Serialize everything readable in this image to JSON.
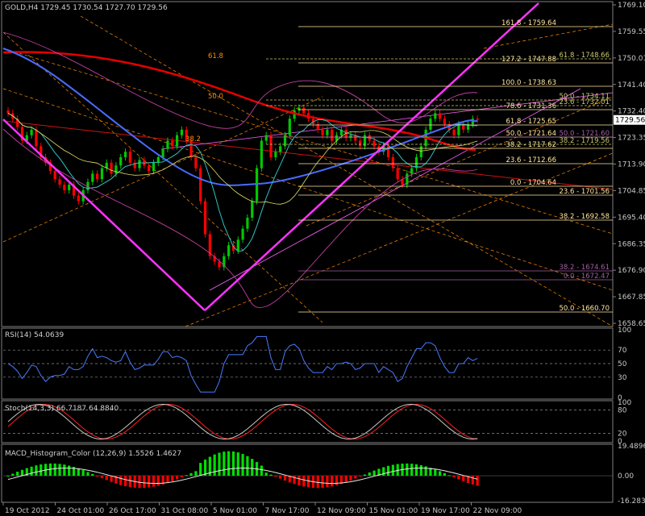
{
  "window": {
    "header_text": "GOLD,H4  1729.45 1730.54 1727.70 1729.56"
  },
  "colors": {
    "background": "#000000",
    "bull_candle": "#00c800",
    "bear_candle": "#ff0000",
    "ma_red": "#e60000",
    "ma_blue": "#4a6bff",
    "bollinger": "#c040a0",
    "trend_magenta": "#ff33ff",
    "fib_orange": "#ff8c00",
    "fib_cream": "#ffe6a0",
    "fib_olive": "#c8c870",
    "fib_purple": "#a060a0",
    "rsi_line": "#4a7bff",
    "stoch_main": "#c8c8c8",
    "stoch_signal": "#ff2020",
    "macd_pos": "#00e000",
    "macd_neg": "#ff0000",
    "macd_signal": "#e8e8e8",
    "current_price_tag_bg": "#ffffff"
  },
  "main_axis": {
    "ticks": [
      "1769.10",
      "1759.55",
      "1750.01",
      "1741.40",
      "1732.40",
      "1723.35",
      "1713.90",
      "1704.85",
      "1695.40",
      "1686.35",
      "1676.90",
      "1667.85",
      "1658.65"
    ],
    "current_price": "1729.56"
  },
  "fib_labels": [
    {
      "text": "161.8 - 1759.64",
      "color": "#ffe6a0"
    },
    {
      "text": "127.2 - 1747.88",
      "color": "#ffe6a0"
    },
    {
      "text": "61.8 - 1748.66",
      "color": "#c8c870"
    },
    {
      "text": "100.0 - 1738.63",
      "color": "#ffe6a0"
    },
    {
      "text": "50.0 - 1734.11",
      "color": "#c8c870"
    },
    {
      "text": "78.6 - 1731.36",
      "color": "#ffe6a0"
    },
    {
      "text": "23.6 - 1732.01",
      "color": "#c8c870"
    },
    {
      "text": "61.8 - 1725.65",
      "color": "#ffe6a0"
    },
    {
      "text": "50.0 - 1721.64",
      "color": "#ffe6a0"
    },
    {
      "text": "50.0 - 1721.60",
      "color": "#a060a0"
    },
    {
      "text": "38.2 - 1717.62",
      "color": "#ffe6a0"
    },
    {
      "text": "38.2 - 1719.56",
      "color": "#c8c870"
    },
    {
      "text": "23.6 - 1712.66",
      "color": "#ffe6a0"
    },
    {
      "text": "0.0 - 1704.64",
      "color": "#ffe6a0"
    },
    {
      "text": "23.6 - 1701.56",
      "color": "#ffe6a0"
    },
    {
      "text": "38.2 - 1692.58",
      "color": "#ffe6a0"
    },
    {
      "text": "38.2 - 1674.61",
      "color": "#a060a0"
    },
    {
      "text": "0.0 - 1672.47",
      "color": "#a060a0"
    },
    {
      "text": "50.0 - 1660.70",
      "color": "#ffe6a0"
    }
  ],
  "fib_mid_labels": [
    "61.8",
    "50.0",
    "38.2"
  ],
  "rsi": {
    "title": "RSI(14) 54.0639",
    "ticks": [
      "100",
      "70",
      "50",
      "30",
      "0"
    ]
  },
  "stoch": {
    "title": "Stoch(14,3,3) 66.7187 64.8840",
    "ticks": [
      "100",
      "80",
      "20",
      "0"
    ]
  },
  "macd": {
    "title": "MACD_Histogram_Color (12,26,9)  1.5526 1.4627",
    "ticks": [
      "19.4896",
      "0.00",
      "-16.283"
    ]
  },
  "time_axis": [
    "19 Oct 2012",
    "24 Oct 01:00",
    "26 Oct 17:00",
    "31 Oct 08:00",
    "5 Nov 01:00",
    "7 Nov 17:00",
    "12 Nov 09:00",
    "15 Nov 01:00",
    "19 Nov 17:00",
    "22 Nov 09:00"
  ],
  "chart_data": {
    "type": "candlestick",
    "symbol": "GOLD",
    "timeframe": "H4",
    "ylim": [
      1655,
      1772
    ],
    "closes": [
      1732,
      1730,
      1727,
      1722,
      1724,
      1726,
      1720,
      1716,
      1714,
      1711,
      1708,
      1706,
      1704,
      1706,
      1702,
      1700,
      1704,
      1707,
      1710,
      1708,
      1712,
      1714,
      1710,
      1713,
      1716,
      1718,
      1714,
      1712,
      1715,
      1713,
      1711,
      1714,
      1716,
      1719,
      1722,
      1720,
      1724,
      1726,
      1722,
      1716,
      1712,
      1700,
      1688,
      1680,
      1678,
      1676,
      1680,
      1684,
      1682,
      1686,
      1690,
      1694,
      1700,
      1712,
      1722,
      1724,
      1716,
      1718,
      1720,
      1724,
      1730,
      1733,
      1734,
      1732,
      1730,
      1728,
      1726,
      1724,
      1726,
      1722,
      1724,
      1726,
      1723,
      1724,
      1722,
      1720,
      1724,
      1722,
      1720,
      1718,
      1720,
      1716,
      1712,
      1708,
      1706,
      1710,
      1712,
      1716,
      1720,
      1726,
      1730,
      1732,
      1730,
      1728,
      1726,
      1724,
      1728,
      1726,
      1728,
      1730,
      1729.56
    ]
  }
}
